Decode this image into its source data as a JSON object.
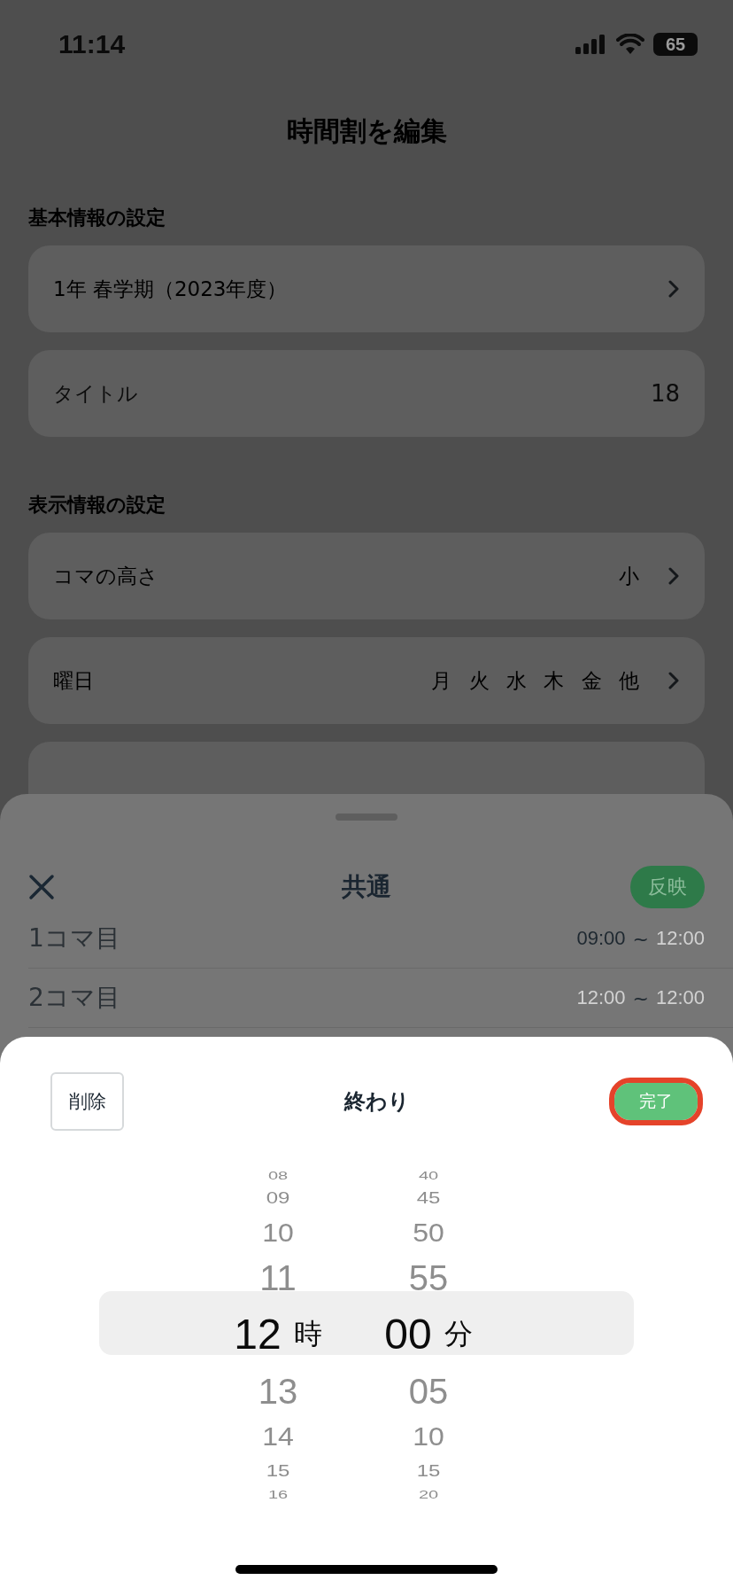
{
  "status_bar": {
    "time": "11:14",
    "battery": "65"
  },
  "header": {
    "title": "時間割を編集"
  },
  "sections": [
    {
      "title": "基本情報の設定",
      "rows": [
        {
          "kind": "nav",
          "label": "1年 春学期（2023年度）"
        },
        {
          "kind": "input",
          "placeholder": "タイトル",
          "counter": "18"
        }
      ]
    },
    {
      "title": "表示情報の設定",
      "rows": [
        {
          "kind": "nav",
          "label": "コマの高さ",
          "value": "小"
        },
        {
          "kind": "nav",
          "label": "曜日",
          "value": "月 火 水 木 金 他"
        },
        {
          "kind": "covered"
        }
      ]
    }
  ],
  "period_sheet": {
    "title": "共通",
    "apply_button": "反映",
    "periods": [
      {
        "label": "1コマ目",
        "start": "09:00",
        "separator": "~",
        "end": "12:00",
        "start_set": true,
        "end_set": false
      },
      {
        "label": "2コマ目",
        "start": "12:00",
        "separator": "~",
        "end": "12:00",
        "start_set": false,
        "end_set": false
      }
    ]
  },
  "picker_sheet": {
    "title": "終わり",
    "delete_button": "削除",
    "done_button": "完了",
    "done_highlighted": true,
    "columns": [
      {
        "unit": "時",
        "items": [
          {
            "label": "08",
            "selected": false
          },
          {
            "label": "09",
            "selected": false
          },
          {
            "label": "10",
            "selected": false
          },
          {
            "label": "11",
            "selected": false
          },
          {
            "label": "12",
            "selected": true
          },
          {
            "label": "13",
            "selected": false
          },
          {
            "label": "14",
            "selected": false
          },
          {
            "label": "15",
            "selected": false
          },
          {
            "label": "16",
            "selected": false
          }
        ]
      },
      {
        "unit": "分",
        "items": [
          {
            "label": "40",
            "selected": false
          },
          {
            "label": "45",
            "selected": false
          },
          {
            "label": "50",
            "selected": false
          },
          {
            "label": "55",
            "selected": false
          },
          {
            "label": "00",
            "selected": true
          },
          {
            "label": "05",
            "selected": false
          },
          {
            "label": "10",
            "selected": false
          },
          {
            "label": "15",
            "selected": false
          },
          {
            "label": "20",
            "selected": false
          }
        ]
      }
    ]
  }
}
